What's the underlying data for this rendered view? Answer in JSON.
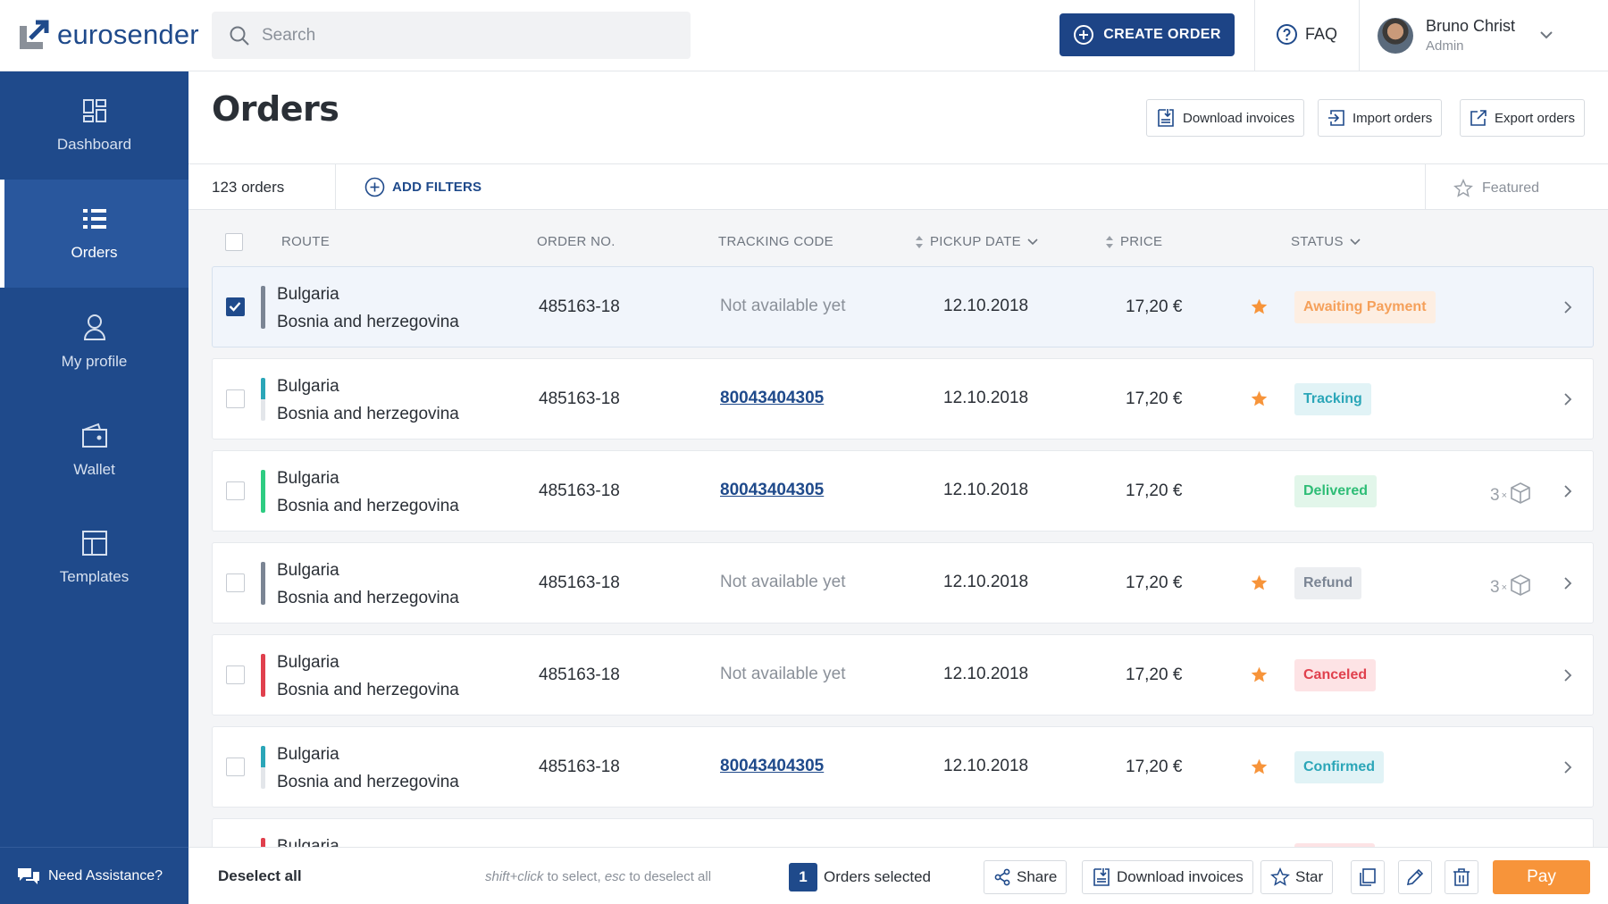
{
  "app": {
    "logo_text": "eurosender"
  },
  "search": {
    "placeholder": "Search"
  },
  "header": {
    "create_order": "CREATE ORDER",
    "faq": "FAQ",
    "user_name": "Bruno Christ",
    "user_role": "Admin"
  },
  "sidebar": {
    "items": [
      {
        "label": "Dashboard",
        "icon": "dashboard-icon"
      },
      {
        "label": "Orders",
        "icon": "list-icon",
        "active": true
      },
      {
        "label": "My profile",
        "icon": "user-icon"
      },
      {
        "label": "Wallet",
        "icon": "wallet-icon"
      },
      {
        "label": "Templates",
        "icon": "templates-icon"
      }
    ],
    "assistance": "Need Assistance?"
  },
  "page": {
    "title": "Orders",
    "download_invoices": "Download invoices",
    "import_orders": "Import orders",
    "export_orders": "Export orders"
  },
  "filters": {
    "count": "123 orders",
    "add_filters": "ADD FILTERS",
    "featured": "Featured"
  },
  "columns": {
    "route": "ROUTE",
    "order_no": "ORDER NO.",
    "tracking": "TRACKING CODE",
    "pickup": "PICKUP DATE",
    "price": "PRICE",
    "status": "STATUS"
  },
  "orders": [
    {
      "from": "Bulgaria",
      "to": "Bosnia and herzegovina",
      "order_no": "485163-18",
      "tracking": "Not available yet",
      "tracking_link": false,
      "pickup": "12.10.2018",
      "price": "17,20 €",
      "starred": true,
      "status": "Awaiting Payment",
      "status_color": "#f5a05a",
      "status_bg": "#fdeee2",
      "bar_top": "#7b8594",
      "bar_bottom": "#7b8594",
      "packages": "",
      "selected": true
    },
    {
      "from": "Bulgaria",
      "to": "Bosnia and herzegovina",
      "order_no": "485163-18",
      "tracking": "80043404305",
      "tracking_link": true,
      "pickup": "12.10.2018",
      "price": "17,20 €",
      "starred": true,
      "status": "Tracking",
      "status_color": "#2ba6b8",
      "status_bg": "#e1f3f6",
      "bar_top": "#2ba6b8",
      "bar_bottom": "#e3e6ea",
      "packages": "",
      "selected": false
    },
    {
      "from": "Bulgaria",
      "to": "Bosnia and herzegovina",
      "order_no": "485163-18",
      "tracking": "80043404305",
      "tracking_link": true,
      "pickup": "12.10.2018",
      "price": "17,20 €",
      "starred": false,
      "status": "Delivered",
      "status_color": "#2ebd76",
      "status_bg": "#e2f6ea",
      "bar_top": "#2ecc82",
      "bar_bottom": "#2ecc82",
      "packages": "3",
      "selected": false
    },
    {
      "from": "Bulgaria",
      "to": "Bosnia and herzegovina",
      "order_no": "485163-18",
      "tracking": "Not available yet",
      "tracking_link": false,
      "pickup": "12.10.2018",
      "price": "17,20 €",
      "starred": true,
      "status": "Refund",
      "status_color": "#7b8594",
      "status_bg": "#eceef1",
      "bar_top": "#7b8594",
      "bar_bottom": "#7b8594",
      "packages": "3",
      "selected": false
    },
    {
      "from": "Bulgaria",
      "to": "Bosnia and herzegovina",
      "order_no": "485163-18",
      "tracking": "Not available yet",
      "tracking_link": false,
      "pickup": "12.10.2018",
      "price": "17,20 €",
      "starred": true,
      "status": "Canceled",
      "status_color": "#e0404d",
      "status_bg": "#fde3e5",
      "bar_top": "#e0404d",
      "bar_bottom": "#e0404d",
      "packages": "",
      "selected": false
    },
    {
      "from": "Bulgaria",
      "to": "Bosnia and herzegovina",
      "order_no": "485163-18",
      "tracking": "80043404305",
      "tracking_link": true,
      "pickup": "12.10.2018",
      "price": "17,20 €",
      "starred": true,
      "status": "Confirmed",
      "status_color": "#2ba6b8",
      "status_bg": "#e1f3f6",
      "bar_top": "#2ba6b8",
      "bar_bottom": "#e3e6ea",
      "packages": "",
      "selected": false
    },
    {
      "from": "Bulgaria",
      "to": "",
      "order_no": "",
      "tracking": "",
      "tracking_link": false,
      "pickup": "",
      "price": "",
      "starred": false,
      "status": "",
      "status_color": "#e0404d",
      "status_bg": "#fde3e5",
      "bar_top": "#e0404d",
      "bar_bottom": "#e0404d",
      "packages": "",
      "selected": false
    }
  ],
  "bottom": {
    "deselect_all": "Deselect all",
    "hint_key1": "shift+click",
    "hint_mid": " to select, ",
    "hint_key2": "esc",
    "hint_end": " to deselect all",
    "selected_count": "1",
    "selected_label": "Orders selected",
    "share": "Share",
    "download_invoices": "Download invoices",
    "star": "Star",
    "pay": "Pay"
  },
  "colors": {
    "brand": "#1f4a8b",
    "accent": "#f7943a",
    "star": "#f7943a"
  }
}
